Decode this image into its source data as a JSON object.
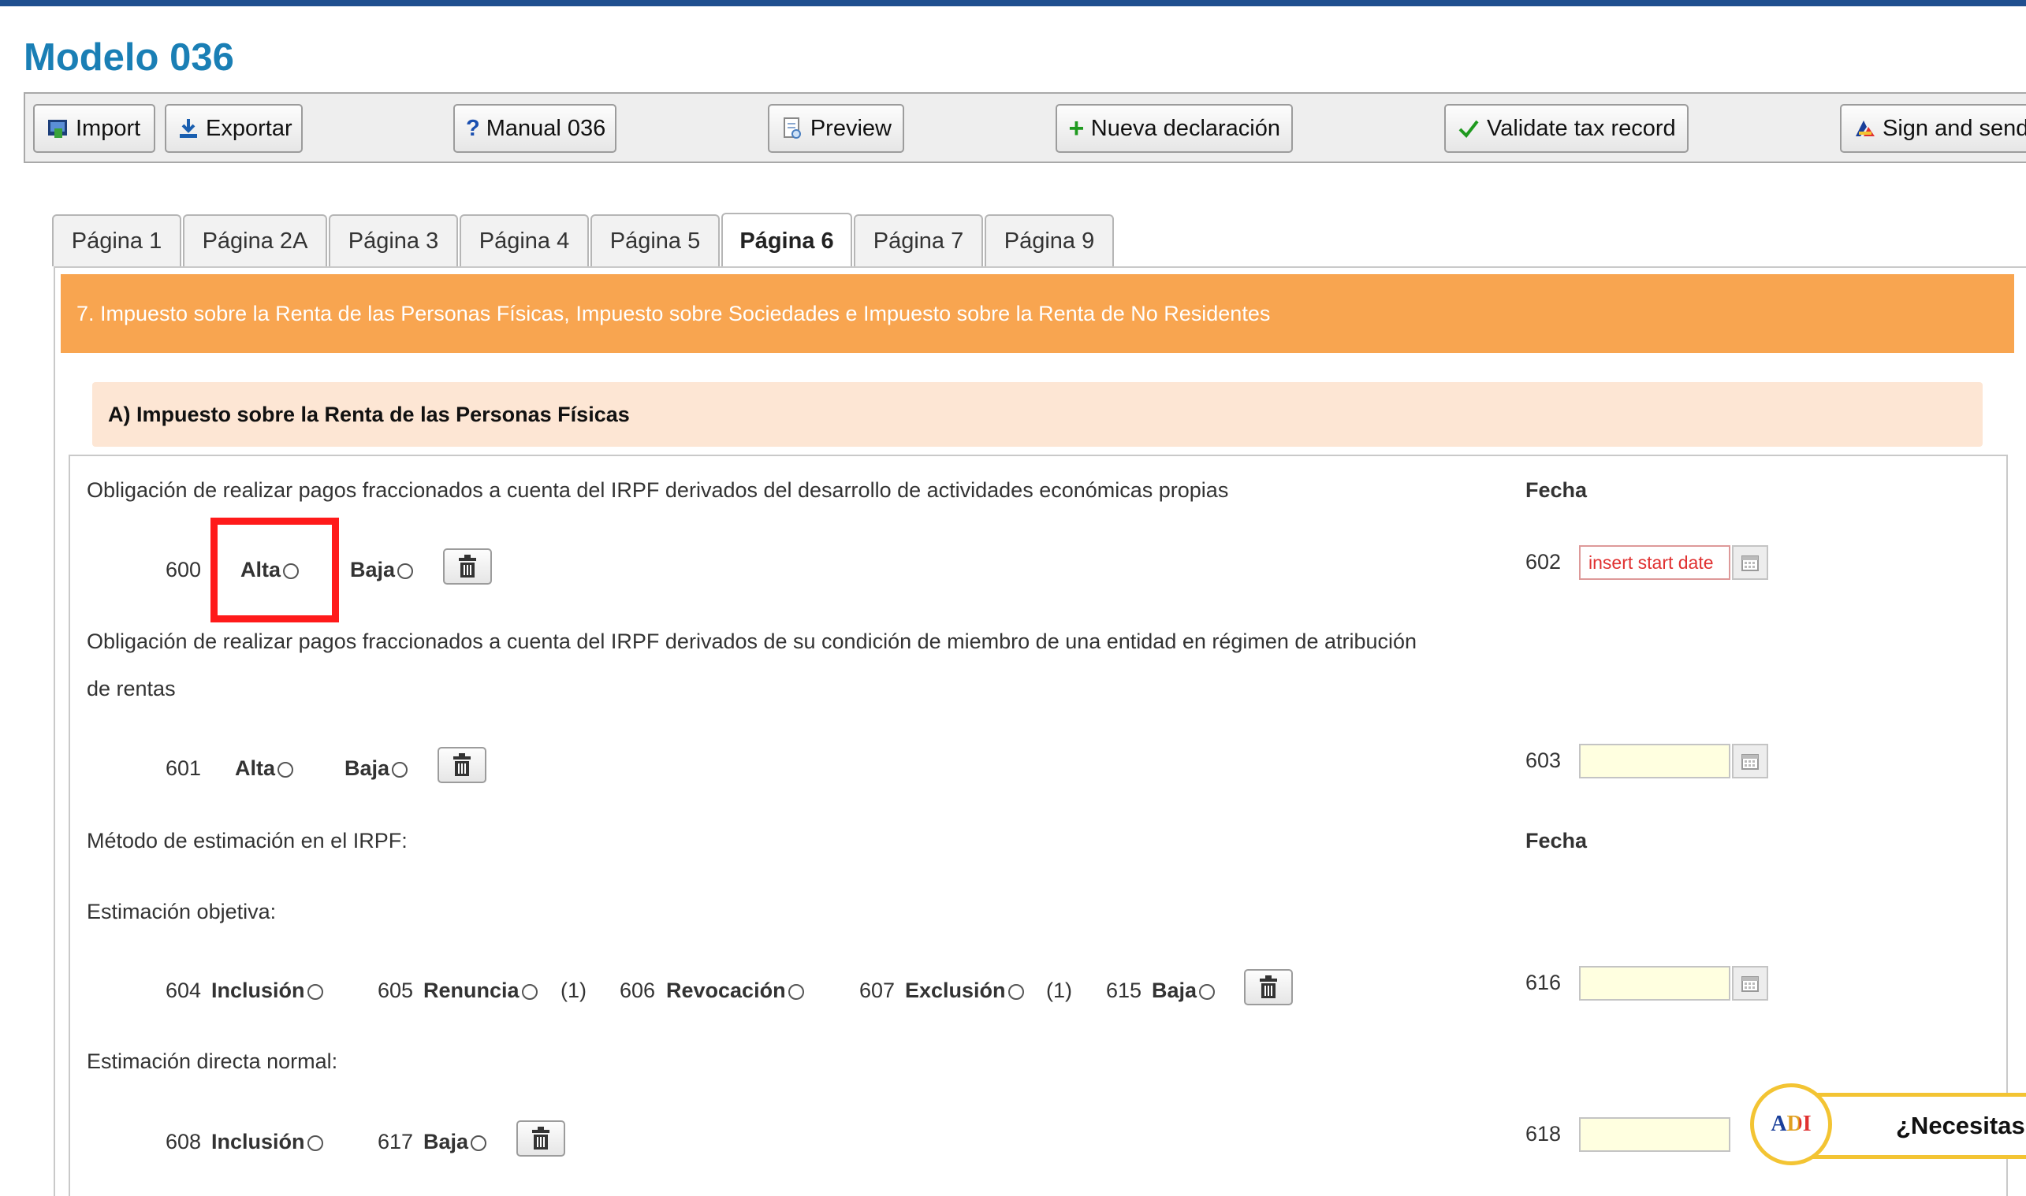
{
  "app": {
    "title": "Modelo 036"
  },
  "toolbar": {
    "import": "Import",
    "export": "Exportar",
    "manual": "Manual 036",
    "preview": "Preview",
    "new": "Nueva declaración",
    "validate": "Validate tax record",
    "sign": "Sign and send"
  },
  "tabs": [
    {
      "label": "Página 1"
    },
    {
      "label": "Página 2A"
    },
    {
      "label": "Página 3"
    },
    {
      "label": "Página 4"
    },
    {
      "label": "Página 5"
    },
    {
      "label": "Página 6",
      "active": true
    },
    {
      "label": "Página 7"
    },
    {
      "label": "Página 9"
    }
  ],
  "section": {
    "header": "7. Impuesto sobre la Renta de las Personas Físicas, Impuesto sobre Sociedades e Impuesto sobre la Renta de No Residentes",
    "subheader": "A) Impuesto sobre la Renta de las Personas Físicas"
  },
  "rows": {
    "obligation1": "Obligación de realizar pagos fraccionados a cuenta del IRPF derivados del desarrollo de actividades económicas propias",
    "fecha1": "Fecha",
    "code600": "600",
    "alta": "Alta",
    "baja": "Baja",
    "code602": "602",
    "date602_placeholder": "insert start date",
    "obligation2_line1": "Obligación de realizar pagos fraccionados a cuenta del IRPF derivados de su condición de miembro de una entidad en régimen de atribución",
    "obligation2_line2": "de rentas",
    "code601": "601",
    "code603": "603",
    "method": "Método de estimación en el IRPF:",
    "fecha2": "Fecha",
    "objetiva": "Estimación objetiva:",
    "code604": "604",
    "inclusion": "Inclusión",
    "code605": "605",
    "renuncia": "Renuncia",
    "note1": "(1)",
    "code606": "606",
    "revocacion": "Revocación",
    "code607": "607",
    "exclusion": "Exclusión",
    "code615": "615",
    "code616": "616",
    "directa": "Estimación directa normal:",
    "code608": "608",
    "code617": "617",
    "code618": "618"
  },
  "help": {
    "label": "¿Necesitas ayuda?",
    "logo": "ADI"
  },
  "colors": {
    "accent": "#1a7fb5",
    "orange": "#f8a550",
    "peach": "#fde6d4",
    "highlight": "#ff1a1a"
  }
}
